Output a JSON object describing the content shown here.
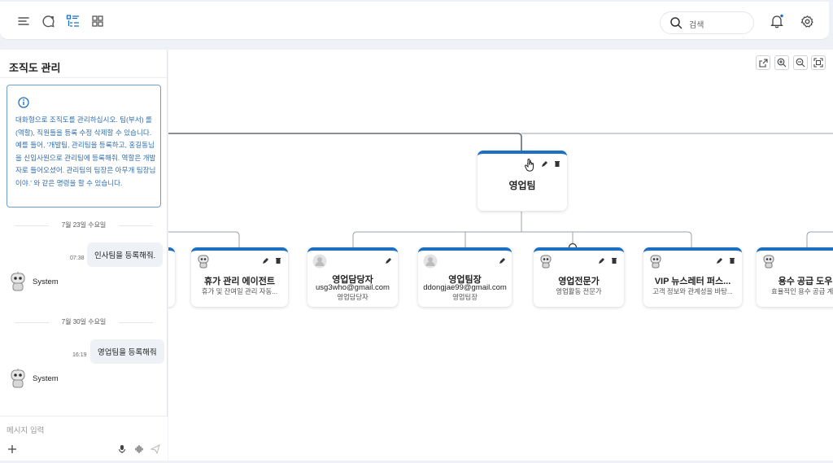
{
  "topbar": {
    "icons": [
      "menu-icon",
      "chat-bubble-icon",
      "list-tree-icon",
      "grid-icon"
    ],
    "search_placeholder": "검색",
    "right_icons": [
      "bell-icon",
      "settings-icon"
    ]
  },
  "sidebar": {
    "title": "조직도 관리",
    "info_text": "대화형으로 조직도를 관리하십시오. 팀(부서) 롤(역할), 직원들을 등록 수정 삭제할 수 있습니다. 예를 들어, '개발팀, 관리팀을 등록하고, 홍길동님을 신입사원으로 관리팀에 등록해줘. 역할은 개발자로 들어오셨어. 관리팀의 팀장은 아무개 팀장님이야.' 와 같은 명령을 할 수 있습니다.",
    "messages": [
      {
        "date": "7월 23일 수요일",
        "time": "07:38",
        "user_text": "인사팀을 등록해줘.",
        "system_label": "System"
      },
      {
        "date": "7월 30일 수요일",
        "time": "16:19",
        "user_text": "영업팀을 등록해줘",
        "system_label": "System"
      }
    ],
    "input_placeholder": "메시지 입력"
  },
  "canvas": {
    "root": {
      "title": "영업팀"
    },
    "children": [
      {
        "title": "휴가 관리 에이전트",
        "subtitle": "휴가 및 잔여일 관리 자동...",
        "avatar": "robot"
      },
      {
        "title": "영업담당자",
        "email": "usg3who@gmail.com",
        "subtitle": "영업담당자",
        "avatar": "person"
      },
      {
        "title": "영업팀장",
        "email": "ddongjae99@gmail.com",
        "subtitle": "영업팀장",
        "avatar": "person"
      },
      {
        "title": "영업전문가",
        "subtitle": "영업활동 전문가",
        "avatar": "robot"
      },
      {
        "title": "VIP 뉴스레터 퍼스...",
        "subtitle": "고객 정보와 관계성을 바탕...",
        "avatar": "robot"
      },
      {
        "title": "용수 공급 도우",
        "subtitle": "효율적인 용수 공급 계획",
        "avatar": "robot"
      }
    ],
    "toolbar_icons": [
      "open-external-icon",
      "zoom-in-icon",
      "zoom-out-icon",
      "fit-screen-icon"
    ]
  },
  "colors": {
    "accent": "#1d6fc2",
    "info_text": "#2f6fb3",
    "info_border": "#6a9fd8"
  }
}
